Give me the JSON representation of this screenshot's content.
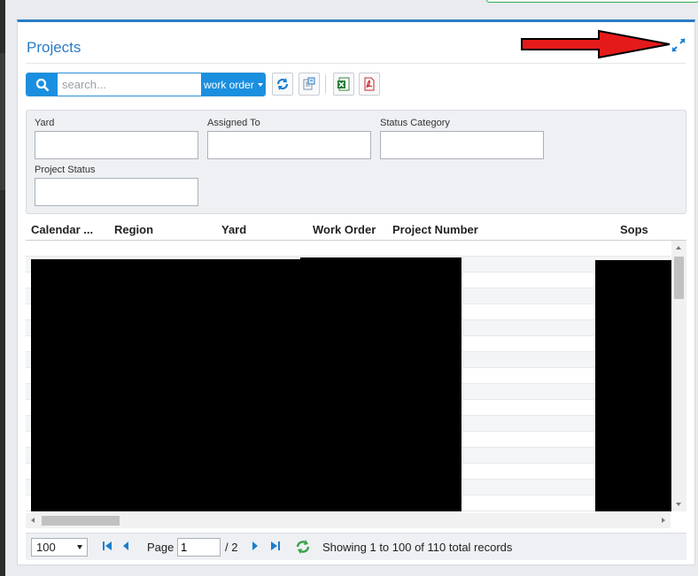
{
  "panel": {
    "title": "Projects"
  },
  "toolbar": {
    "search_placeholder": "search...",
    "search_value": "",
    "filter_field": "work order"
  },
  "filters": {
    "yard_label": "Yard",
    "assigned_to_label": "Assigned To",
    "status_category_label": "Status Category",
    "project_status_label": "Project Status"
  },
  "grid": {
    "columns": [
      "Calendar ...",
      "Region",
      "Yard",
      "Work Order",
      "Project Number",
      "Sops"
    ]
  },
  "pager": {
    "page_size": "100",
    "page_label": "Page",
    "page_value": "1",
    "page_total": "/ 2",
    "summary": "Showing 1 to 100 of 110 total records"
  },
  "colors": {
    "accent": "#2a7cc4",
    "search_button": "#1a8fe0",
    "annotation_arrow": "#e41a1a"
  },
  "icons": {
    "search": "search-icon",
    "expand": "expand-icon",
    "refresh": "refresh-icon",
    "columns": "column-chooser-icon",
    "excel": "excel-export-icon",
    "pdf": "pdf-export-icon",
    "first": "first-page-icon",
    "prev": "prev-page-icon",
    "next": "next-page-icon",
    "last": "last-page-icon",
    "reload": "reload-icon"
  }
}
